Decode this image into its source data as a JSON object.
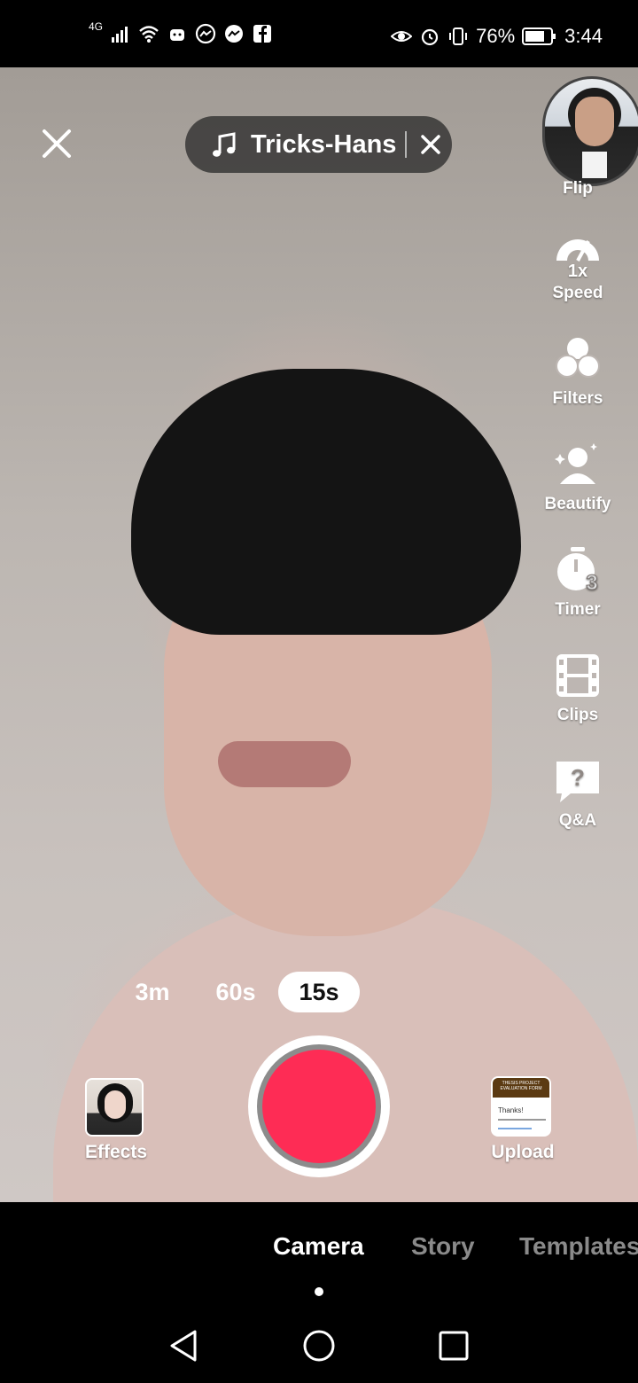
{
  "status_bar": {
    "network": "4G",
    "battery_percent": "76%",
    "time": "3:44",
    "left_icons": [
      "signal-icon",
      "wifi-icon",
      "android-icon",
      "messenger-icon",
      "messenger-icon",
      "facebook-icon"
    ],
    "right_icons": [
      "eye-icon",
      "alarm-icon",
      "vibrate-icon",
      "battery-icon"
    ]
  },
  "top_bar": {
    "close_icon": "close-icon",
    "sound_title": "Tricks-Hans",
    "sound_icon": "music-note-icon",
    "remove_sound_icon": "close-icon"
  },
  "toolbar": {
    "flip_label": "Flip",
    "speed_label": "Speed",
    "speed_value": "1x",
    "filters_label": "Filters",
    "beautify_label": "Beautify",
    "timer_label": "Timer",
    "timer_value": "3",
    "clips_label": "Clips",
    "qa_label": "Q&A"
  },
  "durations": {
    "options": [
      "3m",
      "60s",
      "15s"
    ],
    "selected": "15s"
  },
  "record_row": {
    "effects_label": "Effects",
    "upload_label": "Upload",
    "upload_thumb_title": "THESIS PROJECT EVALUATION FORM",
    "upload_thumb_text": "Thanks!"
  },
  "modes": {
    "camera": "Camera",
    "story": "Story",
    "templates": "Templates",
    "active": "Camera"
  },
  "colors": {
    "record": "#fe2c55",
    "pill_bg": "#282828",
    "inactive_tab": "#8a8a8a"
  }
}
